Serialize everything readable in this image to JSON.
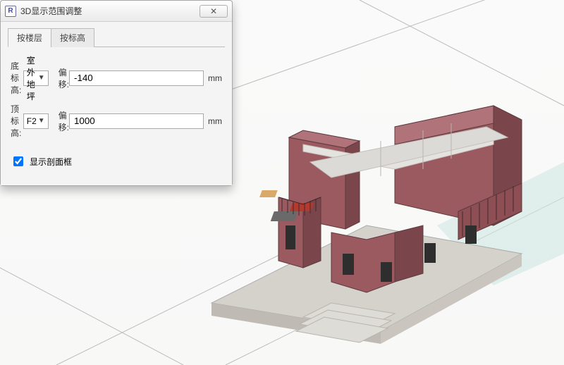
{
  "dialog": {
    "title": "3D显示范围调整",
    "icon_text": "R",
    "close_glyph": "✕",
    "tabs": [
      {
        "label": "按楼层",
        "active": true
      },
      {
        "label": "按标高",
        "active": false
      }
    ],
    "rows": [
      {
        "label": "底标高:",
        "combo_value": "室外地坪",
        "offset_label": "偏移:",
        "offset_value": "-140",
        "unit": "mm"
      },
      {
        "label": "顶标高:",
        "combo_value": "F2",
        "offset_label": "偏移:",
        "offset_value": "1000",
        "unit": "mm"
      }
    ],
    "checkbox": {
      "checked": true,
      "label": "显示剖面框"
    }
  },
  "colors": {
    "wall": "#9a5a60",
    "wall_dark": "#7a464c",
    "floor": "#dcdad6",
    "slab_edge": "#cfc5bf",
    "grass_tint": "#cfe8e2"
  }
}
